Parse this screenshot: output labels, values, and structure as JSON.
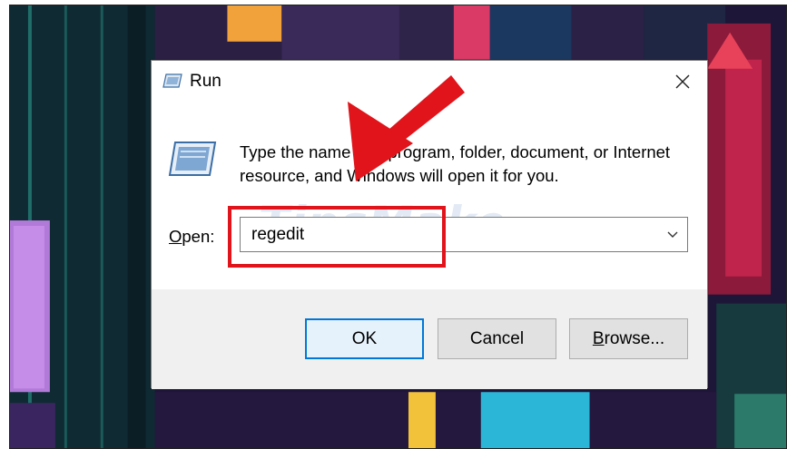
{
  "dialog": {
    "title": "Run",
    "description": "Type the name of a program, folder, document, or Internet resource, and Windows will open it for you.",
    "open_label_underlined": "O",
    "open_label_rest": "pen:",
    "open_value": "regedit"
  },
  "buttons": {
    "ok": "OK",
    "cancel": "Cancel",
    "browse_underlined": "B",
    "browse_rest": "rowse..."
  },
  "watermark": {
    "text": "TipsMake",
    "suffix": ".com"
  },
  "icons": {
    "title": "run-icon",
    "close": "close-icon",
    "dropdown": "chevron-down-icon"
  },
  "colors": {
    "highlight": "#e0141a",
    "arrow": "#e0141a",
    "ok_border": "#0078d7"
  }
}
